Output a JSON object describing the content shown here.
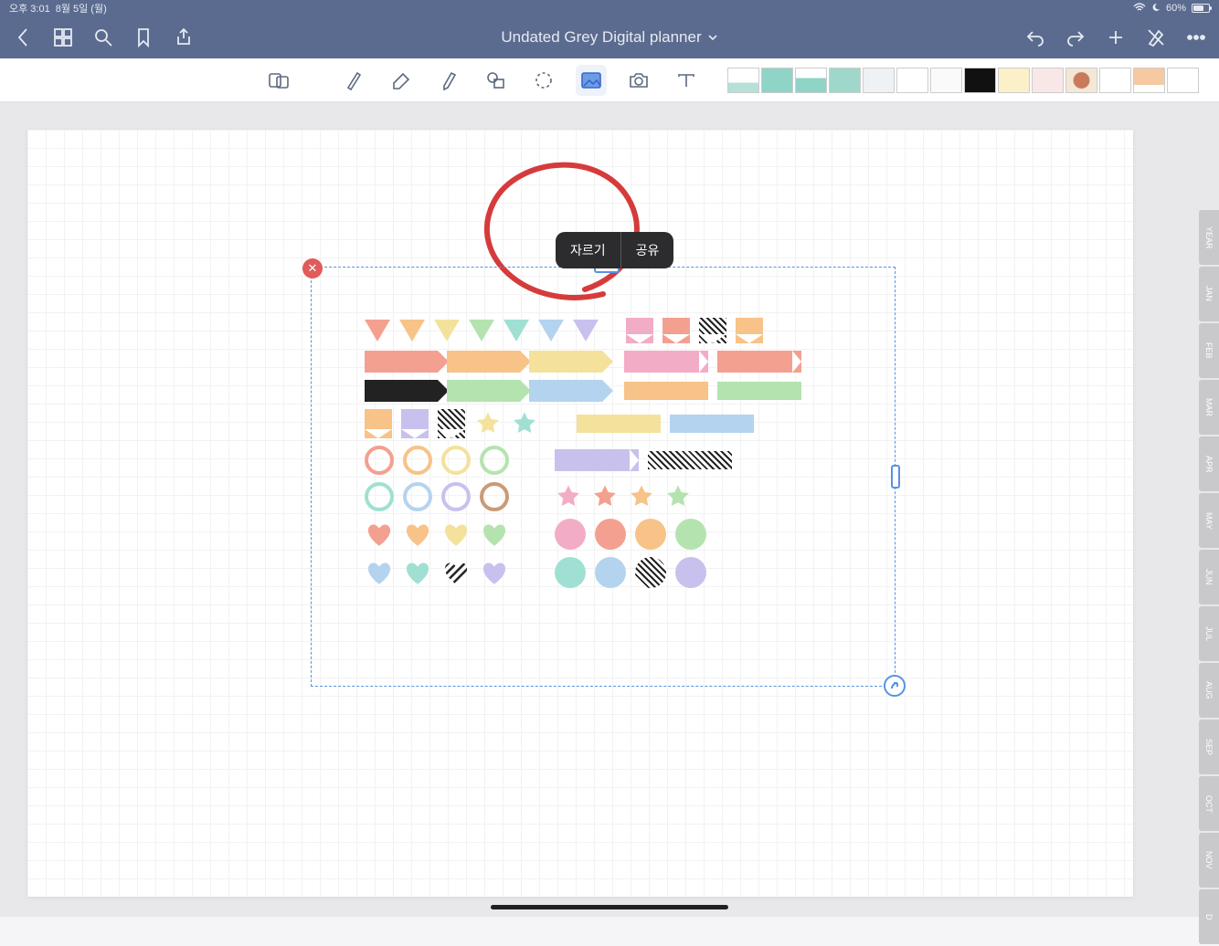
{
  "status": {
    "time": "오후 3:01",
    "date": "8월 5일 (월)",
    "battery_pct": "60%"
  },
  "nav": {
    "title": "Undated Grey Digital planner"
  },
  "popup": {
    "crop": "자르기",
    "share": "공유"
  },
  "side_tabs": [
    "YEAR",
    "JAN",
    "FEB",
    "MAR",
    "APR",
    "MAY",
    "JUN",
    "JUL",
    "AUG",
    "SEP",
    "OCT",
    "NOV",
    "D"
  ],
  "colors": {
    "red": "#f4a090",
    "orange": "#f7c388",
    "yellow": "#f4e29c",
    "green": "#b5e3b0",
    "teal": "#a0e0d2",
    "blue": "#b4d3ee",
    "purple": "#c8c1ee",
    "pink": "#f3acc6",
    "brown": "#c99b77"
  }
}
